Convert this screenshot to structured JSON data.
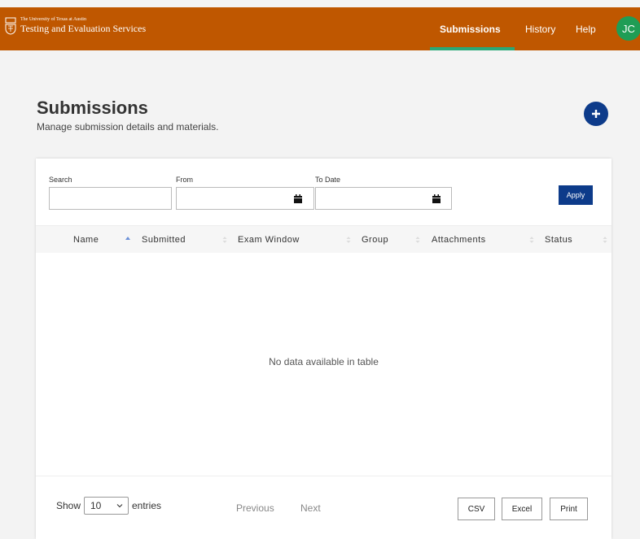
{
  "header": {
    "brand_line1": "The University of Texas at Austin",
    "brand_line2": "Testing and Evaluation Services",
    "nav": [
      {
        "label": "Submissions",
        "active": true
      },
      {
        "label": "History",
        "active": false
      },
      {
        "label": "Help",
        "active": false
      }
    ],
    "avatar_initials": "JC"
  },
  "page": {
    "title": "Submissions",
    "subtitle": "Manage submission details and materials.",
    "add_icon": "plus-circle-icon"
  },
  "filters": {
    "search_label": "Search",
    "from_label": "From",
    "to_label": "To Date",
    "search_value": "",
    "from_value": "",
    "to_value": "",
    "apply_label": "Apply"
  },
  "table": {
    "columns": [
      "Name",
      "Submitted",
      "Exam Window",
      "Group",
      "Attachments",
      "Status"
    ],
    "sorted_column": "Name",
    "empty_message": "No data available in table"
  },
  "footer": {
    "show_label": "Show",
    "entries_value": "10",
    "entries_label": "entries",
    "prev_label": "Previous",
    "next_label": "Next",
    "export_buttons": [
      "CSV",
      "Excel",
      "Print"
    ]
  },
  "colors": {
    "header_bg": "#bf5700",
    "nav_active_underline": "#2aa876",
    "avatar_bg": "#1f9d55",
    "primary": "#0d3b8a"
  }
}
